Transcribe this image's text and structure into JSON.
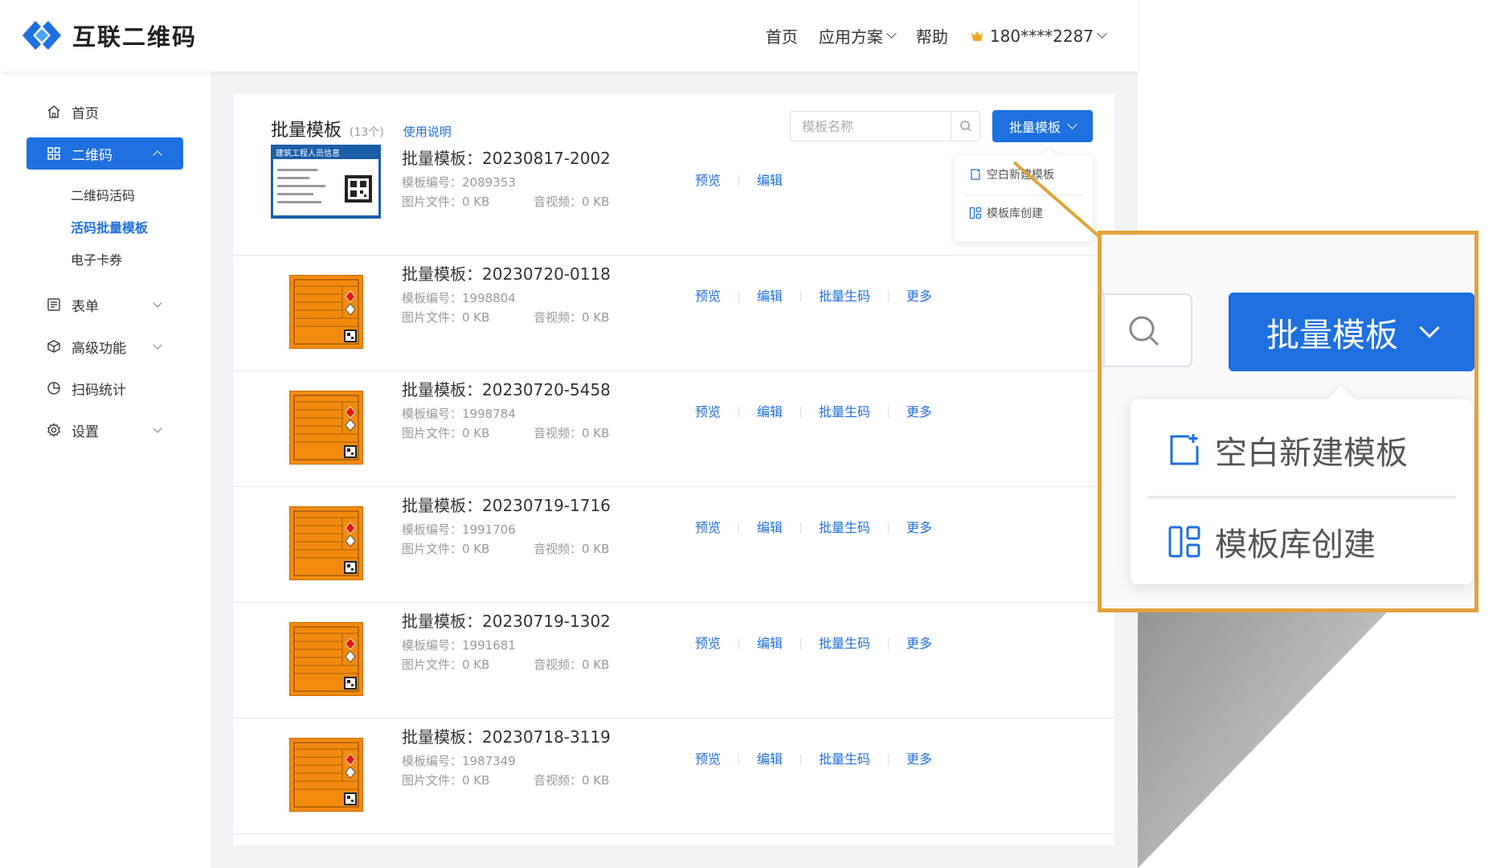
{
  "header": {
    "logo_text": "互联二维码",
    "nav": {
      "home": "首页",
      "solutions": "应用方案",
      "help": "帮助",
      "user": "180****2287"
    }
  },
  "sidebar": {
    "items": [
      {
        "label": "首页",
        "icon": "home-icon"
      },
      {
        "label": "二维码",
        "icon": "grid-icon"
      },
      {
        "label": "表单",
        "icon": "form-icon"
      },
      {
        "label": "高级功能",
        "icon": "cube-icon"
      },
      {
        "label": "扫码统计",
        "icon": "pie-chart-icon"
      },
      {
        "label": "设置",
        "icon": "gear-icon"
      }
    ],
    "sub_items": [
      "二维码活码",
      "活码批量模板",
      "电子卡券"
    ]
  },
  "main": {
    "title": "批量模板",
    "count": "(13个)",
    "help_link": "使用说明",
    "search_placeholder": "模板名称",
    "batch_button": "批量模板",
    "dropdown": {
      "blank": "空白新建模板",
      "library": "模板库创建"
    },
    "rows": [
      {
        "title": "批量模板：20230817-2002",
        "code": "模板编号：2089353",
        "image": "图片文件：0 KB",
        "audio": "音视频：0 KB",
        "actions": [
          "预览",
          "编辑"
        ],
        "thumb": "badge"
      },
      {
        "title": "批量模板：20230720-0118",
        "code": "模板编号：1998804",
        "image": "图片文件：0 KB",
        "audio": "音视频：0 KB",
        "actions": [
          "预览",
          "编辑",
          "批量生码",
          "更多"
        ],
        "thumb": "orange"
      },
      {
        "title": "批量模板：20230720-5458",
        "code": "模板编号：1998784",
        "image": "图片文件：0 KB",
        "audio": "音视频：0 KB",
        "actions": [
          "预览",
          "编辑",
          "批量生码",
          "更多"
        ],
        "thumb": "orange"
      },
      {
        "title": "批量模板：20230719-1716",
        "code": "模板编号：1991706",
        "image": "图片文件：0 KB",
        "audio": "音视频：0 KB",
        "actions": [
          "预览",
          "编辑",
          "批量生码",
          "更多"
        ],
        "thumb": "orange"
      },
      {
        "title": "批量模板：20230719-1302",
        "code": "模板编号：1991681",
        "image": "图片文件：0 KB",
        "audio": "音视频：0 KB",
        "actions": [
          "预览",
          "编辑",
          "批量生码",
          "更多"
        ],
        "thumb": "orange"
      },
      {
        "title": "批量模板：20230718-3119",
        "code": "模板编号：1987349",
        "image": "图片文件：0 KB",
        "audio": "音视频：0 KB",
        "actions": [
          "预览",
          "编辑",
          "批量生码",
          "更多"
        ],
        "thumb": "orange"
      }
    ],
    "badge_thumb_title": "建筑工程人员信息"
  },
  "zoom": {
    "button": "批量模板",
    "blank": "空白新建模板",
    "library": "模板库创建"
  },
  "colors": {
    "primary": "#1e6fe0",
    "callout_border": "#e0a23e",
    "thumb_orange": "#f28b0c"
  }
}
